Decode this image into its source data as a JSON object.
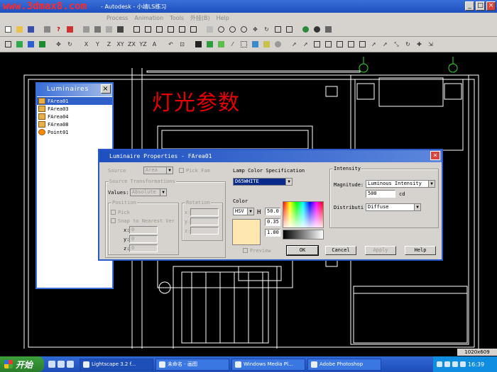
{
  "window": {
    "watermark": "www.3dmax8.com",
    "title": "- Autodesk - 小靖LS练习"
  },
  "menu": [
    "Process",
    "Animation",
    "Tools",
    "外挂(B)",
    "Help"
  ],
  "annotation": "灯光参数",
  "luminaires_panel": {
    "title": "Luminaires",
    "items": [
      "FArea01",
      "FArea03",
      "FArea04",
      "FArea08",
      "Point01"
    ],
    "selected": "FArea01"
  },
  "dialog": {
    "title": "Luminaire Properties - FArea01",
    "source_label": "Source",
    "source_value": "Area",
    "pick_fam": "Pick Fam",
    "source_transformations": "Source Transformations",
    "values_label": "Values:",
    "values_value": "Absolute",
    "position_label": "Position",
    "rotation_label": "Rotation",
    "pick": "Pick",
    "snap": "Snap to Nearest Ver",
    "x": "x:",
    "y": "y:",
    "z": "z:",
    "x_val": "0",
    "y_val": "0",
    "z_val": "0",
    "lamp_color_spec": "Lamp Color Specification",
    "lamp_color_value": "D65WHITE",
    "color_label": "Color",
    "color_model": "HSV",
    "h_label": "H",
    "s_label": "S",
    "v_label": "V",
    "h_value": "50.0",
    "s_value": "0.35",
    "v_value": "1.00",
    "intensity_label": "Intensity",
    "magnitude_label": "Magnitude:",
    "magnitude_value": "Luminous Intensity",
    "intensity_value": "500",
    "unit": "cd",
    "distribution_label": "Distributi",
    "distribution_value": "Diffuse",
    "preview": "Preview",
    "ok": "OK",
    "cancel": "Cancel",
    "apply": "Apply",
    "help": "Help"
  },
  "status": {
    "resolution": "1020x609"
  },
  "taskbar": {
    "start": "开始",
    "tasks": [
      "Lightscape 3.2 f...",
      "未命名 - 画图",
      "Windows Media Pl...",
      "Adobe Photoshop"
    ],
    "clock": "16:39"
  }
}
